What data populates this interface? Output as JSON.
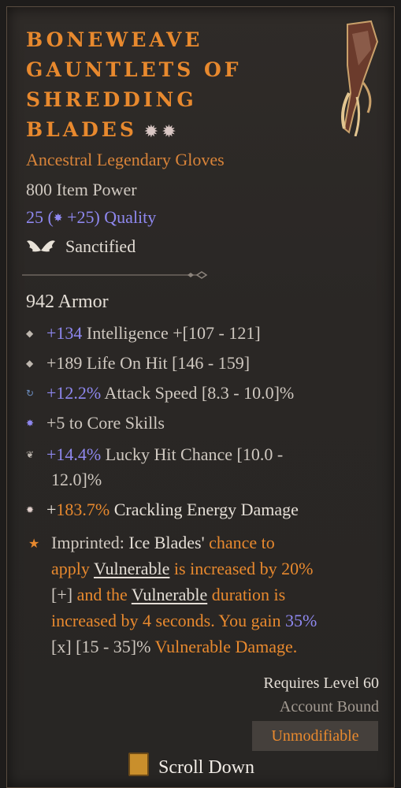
{
  "item": {
    "title_lines": [
      "BONEWEAVE",
      "GAUNTLETS OF",
      "SHREDDING",
      "BLADES"
    ],
    "title_stars": "✹ ✹",
    "type": "Ancestral Legendary Gloves",
    "item_power": "800 Item Power",
    "quality_base": "25 (",
    "quality_bonus": "+25)",
    "quality_label": "Quality",
    "sanctified": "Sanctified",
    "armor": "942 Armor"
  },
  "affixes": [
    {
      "icon": "diamond-icon",
      "value": "+134",
      "text": " Intelligence +[107 - 121]"
    },
    {
      "icon": "diamond-icon",
      "prefix": "+189",
      "text": " Life On Hit [146 - 159]"
    },
    {
      "icon": "swirl-icon",
      "value": "+12.2%",
      "text": " Attack Speed [8.3 - 10.0]%"
    },
    {
      "icon": "spark-icon",
      "text": "+5 to Core Skills"
    },
    {
      "icon": "wing-icon",
      "value": "+14.4%",
      "text": " Lucky Hit Chance [10.0 -",
      "text2": "12.0]%"
    },
    {
      "icon": "burst-icon",
      "prefix": "+",
      "value": "183.7%",
      "text": " Crackling Energy Damage"
    }
  ],
  "aspect": {
    "label": "Imprinted: ",
    "skill": "Ice Blades'",
    "p1": " chance to",
    "p2": "apply ",
    "vuln": "Vulnerable",
    "p3": " is increased by 20%",
    "p4": "[+]",
    "p5": " and the ",
    "vuln2": "Vulnerable",
    "p6": " duration is",
    "p7": "increased by 4 seconds. You gain ",
    "p8": "35%",
    "p9": "[x] [15 - 35]%",
    "p10": " Vulnerable Damage."
  },
  "footer": {
    "requires": "Requires Level 60",
    "bound": "Account Bound",
    "unmodifiable": "Unmodifiable",
    "scroll": "Scroll Down"
  },
  "colors": {
    "legendary": "#e8892e",
    "magic": "#8f88f0",
    "text": "#cfc8c0"
  }
}
